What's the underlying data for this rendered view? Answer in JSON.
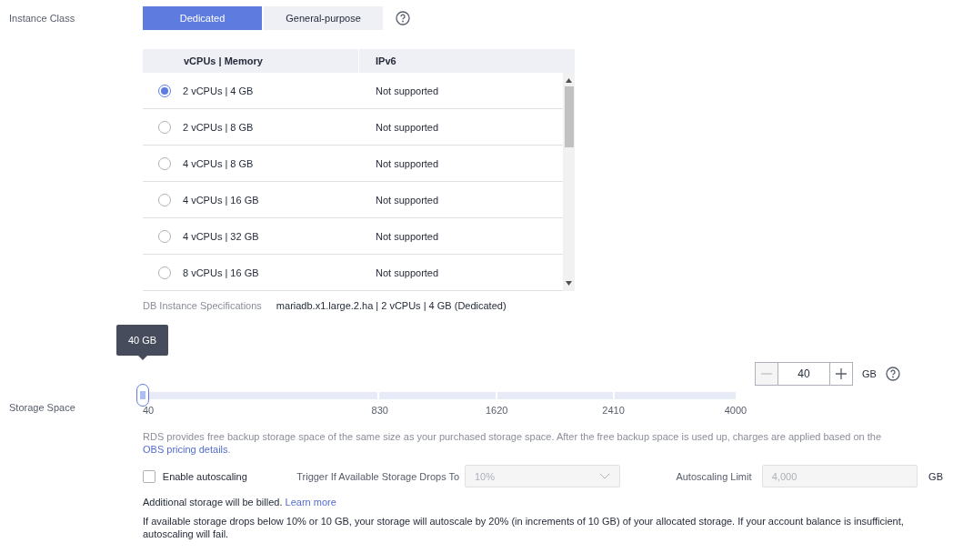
{
  "instance_class": {
    "label": "Instance Class",
    "tabs": [
      {
        "label": "Dedicated",
        "selected": true
      },
      {
        "label": "General-purpose",
        "selected": false
      }
    ],
    "table": {
      "columns": [
        "vCPUs | Memory",
        "IPv6"
      ],
      "rows": [
        {
          "memory": "2 vCPUs | 4 GB",
          "ipv6": "Not supported",
          "selected": true
        },
        {
          "memory": "2 vCPUs | 8 GB",
          "ipv6": "Not supported",
          "selected": false
        },
        {
          "memory": "4 vCPUs | 8 GB",
          "ipv6": "Not supported",
          "selected": false
        },
        {
          "memory": "4 vCPUs | 16 GB",
          "ipv6": "Not supported",
          "selected": false
        },
        {
          "memory": "4 vCPUs | 32 GB",
          "ipv6": "Not supported",
          "selected": false
        },
        {
          "memory": "8 vCPUs | 16 GB",
          "ipv6": "Not supported",
          "selected": false
        }
      ]
    },
    "spec_label": "DB Instance Specifications",
    "spec_value": "mariadb.x1.large.2.ha | 2 vCPUs | 4 GB (Dedicated)"
  },
  "storage": {
    "label": "Storage Space",
    "tooltip": "40 GB",
    "slider": {
      "level": 0
    },
    "ticks": [
      "40",
      "830",
      "1620",
      "2410",
      "4000"
    ],
    "stepper": {
      "value": "40",
      "unit": "GB"
    },
    "note": "RDS provides free backup storage space of the same size as your purchased storage space. After the free backup space is used up, charges are applied based on the ",
    "note_link": "OBS pricing details",
    "note_end": ".",
    "autoscaling": {
      "checked": false,
      "label": "Enable autoscaling",
      "trigger_label": "Trigger If Available Storage Drops To",
      "trigger_value": "10%",
      "limit_label": "Autoscaling Limit",
      "limit_value": "4,000",
      "unit": "GB"
    },
    "billed_note": "Additional storage will be billed. ",
    "billed_link": "Learn more",
    "info": "If available storage drops below 10% or 10 GB, your storage will autoscale by 20% (in increments of 10 GB) of your allocated storage. If your account balance is insufficient, autoscaling will fail."
  }
}
